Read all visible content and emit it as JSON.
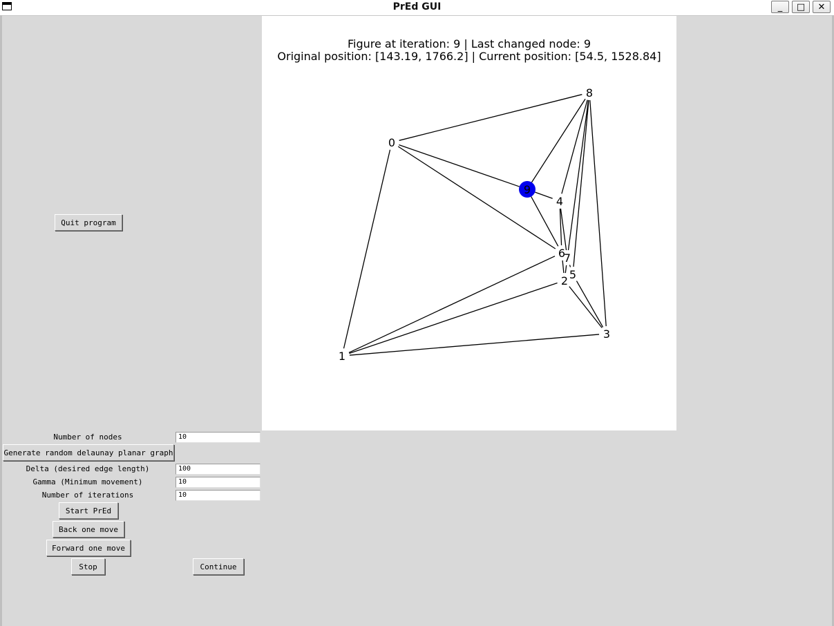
{
  "window": {
    "title": "PrEd GUI",
    "icon": "window-menu-icon",
    "controls": {
      "minimize": "_",
      "maximize": "□",
      "close": "✕"
    }
  },
  "figure": {
    "title_line1": "Figure at iteration: 9 | Last changed node: 9",
    "title_line2": "Original position: [143.19, 1766.2] | Current position: [54.5, 1528.84]",
    "highlight_color": "#0000ee",
    "highlighted_node": "9",
    "nodes": [
      {
        "id": "0",
        "label": "0"
      },
      {
        "id": "1",
        "label": "1"
      },
      {
        "id": "2",
        "label": "2"
      },
      {
        "id": "3",
        "label": "3"
      },
      {
        "id": "4",
        "label": "4"
      },
      {
        "id": "5",
        "label": "5"
      },
      {
        "id": "6",
        "label": "6"
      },
      {
        "id": "7",
        "label": "7"
      },
      {
        "id": "8",
        "label": "8"
      },
      {
        "id": "9",
        "label": "9"
      }
    ],
    "edges": [
      [
        "0",
        "8"
      ],
      [
        "0",
        "9"
      ],
      [
        "0",
        "6"
      ],
      [
        "0",
        "1"
      ],
      [
        "9",
        "8"
      ],
      [
        "9",
        "4"
      ],
      [
        "9",
        "6"
      ],
      [
        "4",
        "8"
      ],
      [
        "4",
        "6"
      ],
      [
        "4",
        "7"
      ],
      [
        "8",
        "7"
      ],
      [
        "8",
        "5"
      ],
      [
        "8",
        "3"
      ],
      [
        "6",
        "7"
      ],
      [
        "6",
        "1"
      ],
      [
        "6",
        "2"
      ],
      [
        "7",
        "2"
      ],
      [
        "7",
        "5"
      ],
      [
        "5",
        "2"
      ],
      [
        "5",
        "3"
      ],
      [
        "2",
        "1"
      ],
      [
        "2",
        "3"
      ],
      [
        "1",
        "3"
      ]
    ]
  },
  "controls": {
    "quit_label": "Quit program",
    "num_nodes_label": "Number of nodes",
    "num_nodes_value": "10",
    "generate_label": "Generate random delaunay planar graph",
    "delta_label": "Delta (desired edge length)",
    "delta_value": "100",
    "gamma_label": "Gamma (Minimum movement)",
    "gamma_value": "10",
    "iterations_label": "Number of iterations",
    "iterations_value": "10",
    "start_label": "Start PrEd",
    "back_label": "Back one move",
    "forward_label": "Forward one move",
    "stop_label": "Stop",
    "continue_label": "Continue"
  }
}
